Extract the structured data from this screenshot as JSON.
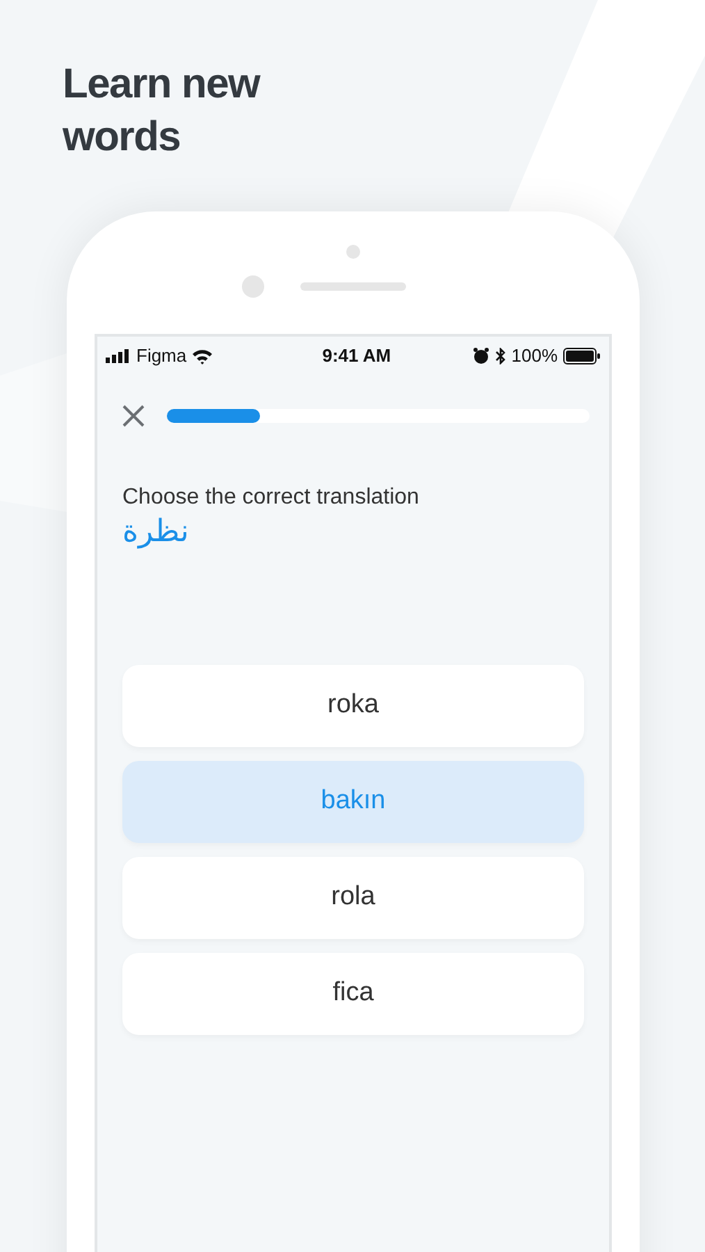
{
  "headline": "Learn new words",
  "status_bar": {
    "carrier": "Figma",
    "time": "9:41 AM",
    "battery": "100%"
  },
  "progress": {
    "level": 0.22
  },
  "prompt": "Choose the correct translation",
  "word": "نظرة",
  "options": [
    {
      "label": "roka",
      "selected": false
    },
    {
      "label": "bakın",
      "selected": true
    },
    {
      "label": "rola",
      "selected": false
    },
    {
      "label": "fica",
      "selected": false
    }
  ]
}
